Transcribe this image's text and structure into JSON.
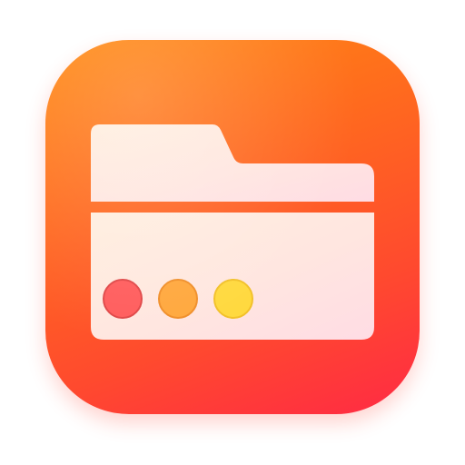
{
  "app_icon": {
    "name": "folder-window-app-icon",
    "icon": "folder-icon",
    "colors": {
      "background_top": "#ff8a10",
      "background_bottom": "#ff2a44",
      "folder_tint_light": "#fff0dc",
      "folder_tint_pink": "#ffdde4",
      "divider": "#ff5a3a"
    },
    "window_controls": [
      {
        "name": "close-dot",
        "color": "#ff5d5d",
        "stroke": "#e04848"
      },
      {
        "name": "minimize-dot",
        "color": "#ffa83e",
        "stroke": "#f08f2a"
      },
      {
        "name": "zoom-dot",
        "color": "#ffd93f",
        "stroke": "#f2c12a"
      }
    ]
  }
}
